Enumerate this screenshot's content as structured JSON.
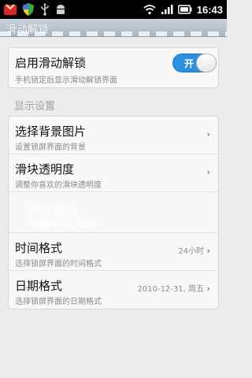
{
  "status_bar": {
    "time": "16:43",
    "left_icons": [
      "lock-app-icon",
      "shield-icon",
      "usb-icon",
      "android-debug-icon"
    ],
    "right_icons": [
      "wifi-icon",
      "signal-icon",
      "battery-icon"
    ]
  },
  "title_bar": {
    "title": "滑动解锁"
  },
  "slide_unlock": {
    "title": "启用滑动解锁",
    "subtitle": "手机锁定后显示滑动解锁界面",
    "toggle_label": "开",
    "enabled": true
  },
  "display_section": {
    "header": "显示设置",
    "items": [
      {
        "title": "选择背景图片",
        "subtitle": "设置锁屏界面的背景",
        "value": "",
        "enabled": true
      },
      {
        "title": "滑块透明度",
        "subtitle": "调整你喜欢的滑块透明度",
        "value": "",
        "enabled": true
      },
      {
        "title": "文字颜色",
        "subtitle": "根据选择的文字颜色",
        "value": "",
        "enabled": false
      },
      {
        "title": "时间格式",
        "subtitle": "选择锁屏界面的时间格式",
        "value": "24小时",
        "enabled": true
      },
      {
        "title": "日期格式",
        "subtitle": "选择锁屏界面的日期格式",
        "value": "2010-12-31, 周五",
        "enabled": true
      }
    ]
  },
  "colors": {
    "accent": "#2c8fdf",
    "status_bar": "#000000",
    "title_bar": "#b3bec8",
    "background": "#ececec"
  }
}
